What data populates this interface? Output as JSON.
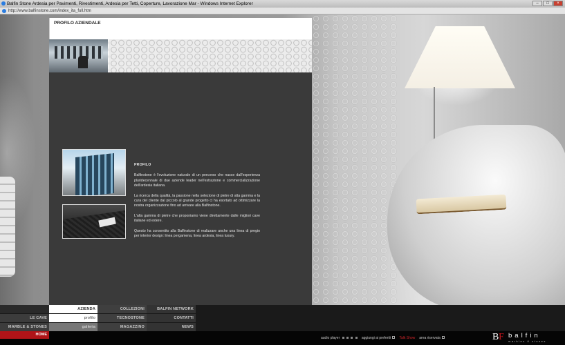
{
  "browser": {
    "title": "Balfin Stone Ardesia per Pavimenti, Rivestimenti, Ardesia per Tetti, Coperture, Lavorazione Mar - Windows Internet Explorer",
    "url": "http://www.balfinstone.com/index_ita_full.htm"
  },
  "header": {
    "title": "PROFILO AZIENDALE"
  },
  "profile": {
    "title": "PROFILO",
    "paragraphs": [
      "Balfinstone è l'evoluzione naturale di un percorso che nasce dall'esperienza pluridecennale di due aziende leader nell'estrazione e commercializzazione dell'ardesia italiana.",
      "La ricerca della qualità, la passione nella selezione di pietre di alta gamma e la cura del cliente dal piccolo al grande progetto ci ha esortato ad ottimizzare la nostra organizzazione fino ad arrivare alla Balfinstone.",
      "L'alta gamma di pietre che proponiamo viene direttamente dalle migliori cave italiane ed estere.",
      "Questo ha consentito alla Balfinstone di realizzare anche una linea di pregio per interior design: linea pergamena, linea ardesia, linea luxury."
    ]
  },
  "menu": {
    "azienda": "AZIENDA",
    "collezioni": "COLLEZIONI",
    "balfin_network": "BALFIN NETWORK",
    "le_cave": "LE CAVE",
    "profilo": "profilo",
    "tecnostone": "TECNOSTONE",
    "contatti": "CONTATTI",
    "marble_stones": "MARBLE & STONES",
    "galleria": "galleria",
    "magazzino": "MAGAZZINO",
    "news": "NEWS",
    "home": "HOME"
  },
  "footer": {
    "audio_player": "audio player",
    "aggiungi_preferiti": "aggiungi ai preferiti",
    "link_red": "Talk Show",
    "area_riservata": "area riservata"
  },
  "brand": {
    "name": "balfin",
    "tagline": "marbles & stones"
  },
  "colors": {
    "accent_red": "#b01418",
    "panel_dark": "#3a3a3a"
  }
}
